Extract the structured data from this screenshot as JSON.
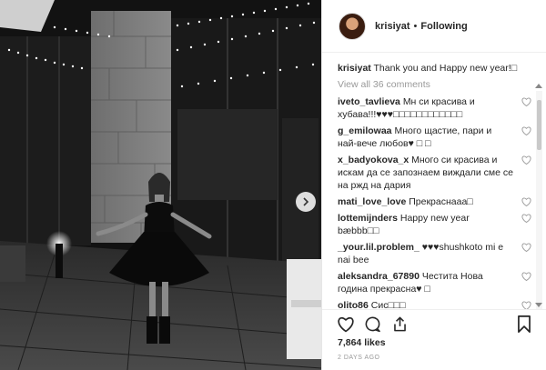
{
  "post": {
    "username": "krisiyat",
    "separator": "•",
    "follow_status": "Following",
    "caption_user": "krisiyat",
    "caption_text": "Thank you and Happy new year!□",
    "view_all": "View all 36 comments",
    "comments": [
      {
        "user": "iveto_tavlieva",
        "text": "Мн си красива и хубава!!!♥♥♥□□□□□□□□□□□□"
      },
      {
        "user": "g_emilowaa",
        "text": "Много щастие, пари и най-вече любов♥ □ □"
      },
      {
        "user": "x_badyokova_x",
        "text": "Много си красива и искам да се запознаем виждали сме се на ржд на дария"
      },
      {
        "user": "mati_love_love",
        "text": "Прекраснааа□"
      },
      {
        "user": "lottemijnders",
        "text": "Happy new year bæbbb□□"
      },
      {
        "user": "_your.lil.problem_",
        "text": "♥♥♥shushkoto mi e nai bee"
      },
      {
        "user": "aleksandra_67890",
        "text": "Честита Нова година прекрасна♥ □"
      },
      {
        "user": "olito86",
        "text": "Сис□□□"
      }
    ],
    "likes": "7,864 likes",
    "date": "2 DAYS AGO"
  },
  "icons": {
    "next": "chevron-right-icon",
    "like": "heart-icon",
    "comment": "comment-bubble-icon",
    "share": "share-icon",
    "save": "bookmark-icon"
  },
  "colors": {
    "text": "#262626",
    "muted": "#999999",
    "border": "#efefef"
  }
}
